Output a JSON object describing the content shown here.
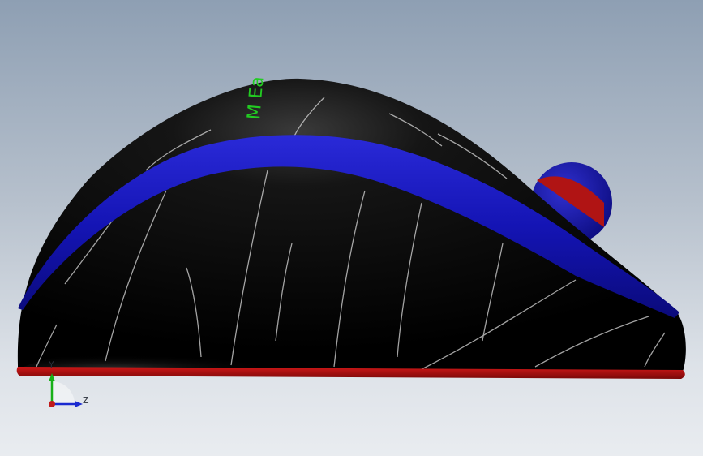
{
  "viewport": {
    "background_top": "#8e9fb3",
    "background_bottom": "#e9ecf0"
  },
  "model": {
    "body_color": "#050505",
    "stripe_color": "#1111b8",
    "base_color": "#b81010",
    "wheel_outer_color": "#1515a8",
    "wheel_inner_color": "#b01515",
    "logo_color": "#22cc22",
    "logo_text": "M Ea"
  },
  "triad": {
    "y_label": "Y",
    "z_label": "Z",
    "y_color": "#18b018",
    "z_color": "#1a2ad0",
    "x_color": "#c01a1a"
  }
}
